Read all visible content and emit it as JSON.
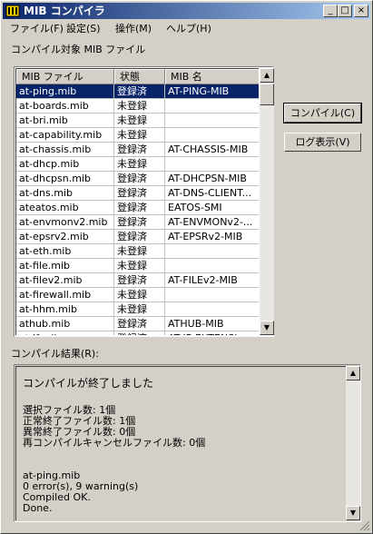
{
  "window": {
    "title": "MIB コンパイラ",
    "minimize_glyph": "_",
    "maximize_glyph": "□",
    "close_glyph": "×",
    "icon": "folder-books-icon",
    "accent_color": "#0a246a"
  },
  "menu": [
    {
      "label": "ファイル(F)"
    },
    {
      "label": "設定(S)"
    },
    {
      "label": "操作(M)"
    },
    {
      "label": "ヘルプ(H)"
    }
  ],
  "list_section_label": "コンパイル対象 MIB ファイル",
  "table": {
    "columns": [
      "MIB ファイル",
      "状態",
      "MIB 名"
    ],
    "rows": [
      {
        "file": "at-ping.mib",
        "status": "登録済",
        "name": "AT-PING-MIB",
        "selected": true
      },
      {
        "file": "at-boards.mib",
        "status": "未登録",
        "name": ""
      },
      {
        "file": "at-bri.mib",
        "status": "未登録",
        "name": ""
      },
      {
        "file": "at-capability.mib",
        "status": "未登録",
        "name": ""
      },
      {
        "file": "at-chassis.mib",
        "status": "登録済",
        "name": "AT-CHASSIS-MIB"
      },
      {
        "file": "at-dhcp.mib",
        "status": "未登録",
        "name": ""
      },
      {
        "file": "at-dhcpsn.mib",
        "status": "登録済",
        "name": "AT-DHCPSN-MIB"
      },
      {
        "file": "at-dns.mib",
        "status": "登録済",
        "name": "AT-DNS-CLIENT..."
      },
      {
        "file": "ateatos.mib",
        "status": "登録済",
        "name": "EATOS-SMI"
      },
      {
        "file": "at-envmonv2.mib",
        "status": "登録済",
        "name": "AT-ENVMONv2-..."
      },
      {
        "file": "at-epsrv2.mib",
        "status": "登録済",
        "name": "AT-EPSRv2-MIB"
      },
      {
        "file": "at-eth.mib",
        "status": "未登録",
        "name": ""
      },
      {
        "file": "at-file.mib",
        "status": "未登録",
        "name": ""
      },
      {
        "file": "at-filev2.mib",
        "status": "登録済",
        "name": "AT-FILEv2-MIB"
      },
      {
        "file": "at-firewall.mib",
        "status": "未登録",
        "name": ""
      },
      {
        "file": "at-hhm.mib",
        "status": "未登録",
        "name": ""
      },
      {
        "file": "athub.mib",
        "status": "登録済",
        "name": "ATHUB-MIB"
      },
      {
        "file": "at-if.mib",
        "status": "登録済",
        "name": "AT-IF-EXTENSI..."
      }
    ]
  },
  "buttons": {
    "compile": "コンパイル(C)",
    "show_log": "ログ表示(V)"
  },
  "result_label": "コンパイル結果(R):",
  "result_lines": [
    "コンパイルが終了しました",
    "",
    "選択ファイル数: 1個",
    "正常終了ファイル数: 1個",
    "異常終了ファイル数: 0個",
    "再コンパイルキャンセルファイル数: 0個",
    "",
    "",
    "at-ping.mib",
    "0 error(s), 9 warning(s)",
    "Compiled OK.",
    "Done."
  ]
}
